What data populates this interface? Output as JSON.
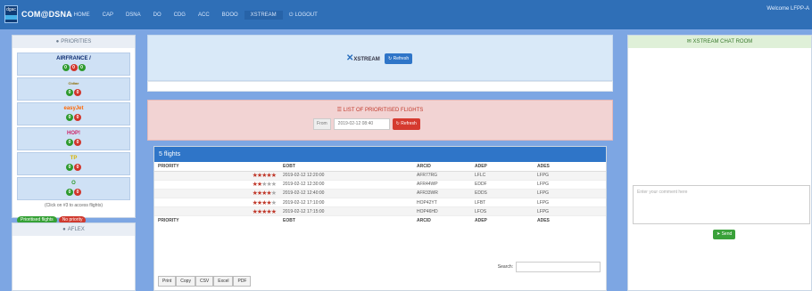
{
  "nav": {
    "brand": "COM@DSNA",
    "logo_text": "dgac",
    "items": [
      {
        "label": "HOME",
        "icon": "home-icon"
      },
      {
        "label": "CAP"
      },
      {
        "label": "DSNA"
      },
      {
        "label": "DO"
      },
      {
        "label": "CDG"
      },
      {
        "label": "ACC"
      },
      {
        "label": "BOOO"
      },
      {
        "label": "XSTREAM"
      },
      {
        "label": "LOGOUT",
        "icon": "power-icon"
      }
    ],
    "active": "XSTREAM",
    "welcome": "Welcome LFPP-A"
  },
  "priorities": {
    "title": "PRIORITIES",
    "airlines": [
      {
        "logo": "AIRFRANCE /",
        "color": "#0b2a6f",
        "circles": [
          "green",
          "red",
          "green"
        ]
      },
      {
        "logo": "Cidiae",
        "color": "#8a6a00",
        "circles": [
          "green",
          "red"
        ]
      },
      {
        "logo": "easyJet",
        "color": "#ff6600",
        "circles": [
          "green",
          "red"
        ]
      },
      {
        "logo": "HOP!",
        "color": "#cc2266",
        "circles": [
          "green",
          "red"
        ]
      },
      {
        "logo": "TP",
        "color": "#d8b400",
        "circles": [
          "green",
          "red"
        ]
      },
      {
        "logo": "O",
        "color": "#2e9a2e",
        "circles": [
          "green",
          "red"
        ]
      }
    ],
    "hint": "(Click on #3 to access flights)",
    "badge_green": "Prioritised flights",
    "badge_red": "No priority"
  },
  "aflex": {
    "title": "AFLEX"
  },
  "xstream": {
    "logo": "XSTREAM",
    "refresh": "Refresh"
  },
  "flights": {
    "title": "LIST OF PRIORITISED FLIGHTS",
    "from_label": "From",
    "from_value": "2019-02-12 08:40",
    "refresh": "Refresh"
  },
  "table": {
    "header": "5 flights",
    "columns": [
      "PRIORITY",
      "EOBT",
      "ARCID",
      "ADEP",
      "ADES",
      ""
    ],
    "rows": [
      {
        "stars": 5,
        "eobt": "2019-02-12 12:20:00",
        "arcid": "AFR77RG",
        "adep": "LFLC",
        "ades": "LFPG"
      },
      {
        "stars": 2,
        "eobt": "2019-02-12 12:30:00",
        "arcid": "AFR44WP",
        "adep": "EDDF",
        "ades": "LFPG"
      },
      {
        "stars": 4,
        "eobt": "2019-02-12 12:40:00",
        "arcid": "AFR33WR",
        "adep": "EDDS",
        "ades": "LFPG"
      },
      {
        "stars": 4,
        "eobt": "2019-02-12 17:10:00",
        "arcid": "HOP42YT",
        "adep": "LFBT",
        "ades": "LFPG"
      },
      {
        "stars": 5,
        "eobt": "2019-02-12 17:15:00",
        "arcid": "HOP46HD",
        "adep": "LFOS",
        "ades": "LFPG"
      }
    ],
    "search_label": "Search:",
    "export": [
      "Print",
      "Copy",
      "CSV",
      "Excel",
      "PDF"
    ]
  },
  "chat": {
    "title": "XSTREAM CHAT ROOM",
    "placeholder": "Enter your comment here",
    "send": "Send"
  }
}
